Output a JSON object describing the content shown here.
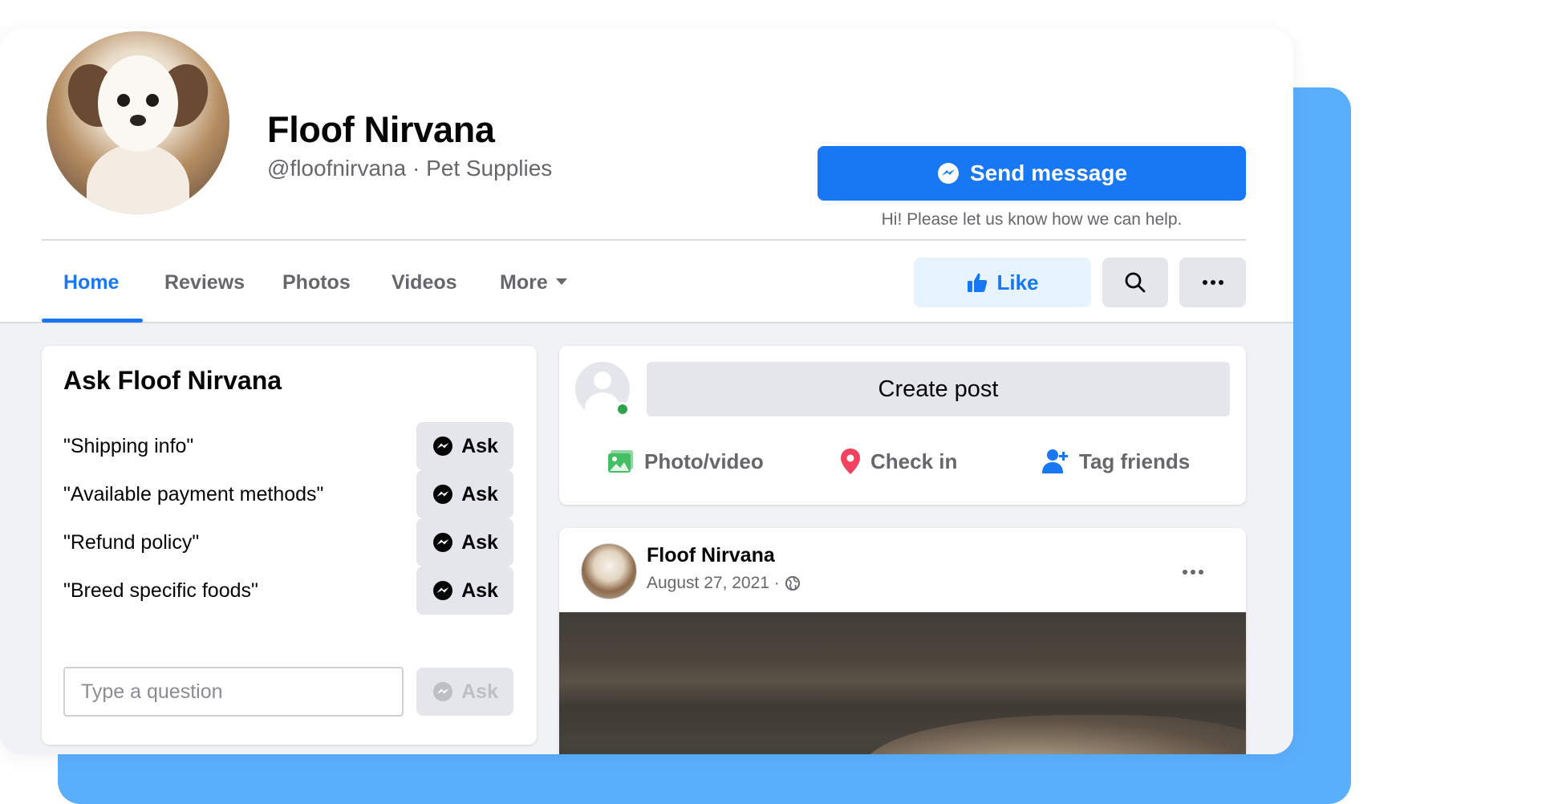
{
  "page": {
    "name": "Floof Nirvana",
    "subtitle": "@floofnirvana · Pet Supplies"
  },
  "header": {
    "send_message_label": "Send message",
    "send_message_hint": "Hi! Please let us know how we can help.",
    "like_label": "Like"
  },
  "nav": {
    "tabs": [
      {
        "label": "Home",
        "active": true
      },
      {
        "label": "Reviews"
      },
      {
        "label": "Photos"
      },
      {
        "label": "Videos"
      },
      {
        "label": "More"
      }
    ]
  },
  "ask": {
    "title": "Ask Floof Nirvana",
    "questions": [
      {
        "text": "\"Shipping info\"",
        "button": "Ask"
      },
      {
        "text": "\"Available payment methods\"",
        "button": "Ask"
      },
      {
        "text": "\"Refund policy\"",
        "button": "Ask"
      },
      {
        "text": "\"Breed specific foods\"",
        "button": "Ask"
      }
    ],
    "input_placeholder": "Type a question",
    "input_button": "Ask"
  },
  "composer": {
    "create_post_label": "Create post",
    "actions": [
      {
        "label": "Photo/video",
        "icon": "photo-video-icon",
        "color": "#45bd62"
      },
      {
        "label": "Check in",
        "icon": "location-pin-icon",
        "color": "#f3425f"
      },
      {
        "label": "Tag friends",
        "icon": "tag-friends-icon",
        "color": "#1877f2"
      }
    ]
  },
  "post": {
    "author": "Floof Nirvana",
    "date": "August 27, 2021 ·"
  },
  "colors": {
    "brand": "#1877f2",
    "like_bg": "#e7f3ff",
    "backdrop": "#5aaffd"
  }
}
